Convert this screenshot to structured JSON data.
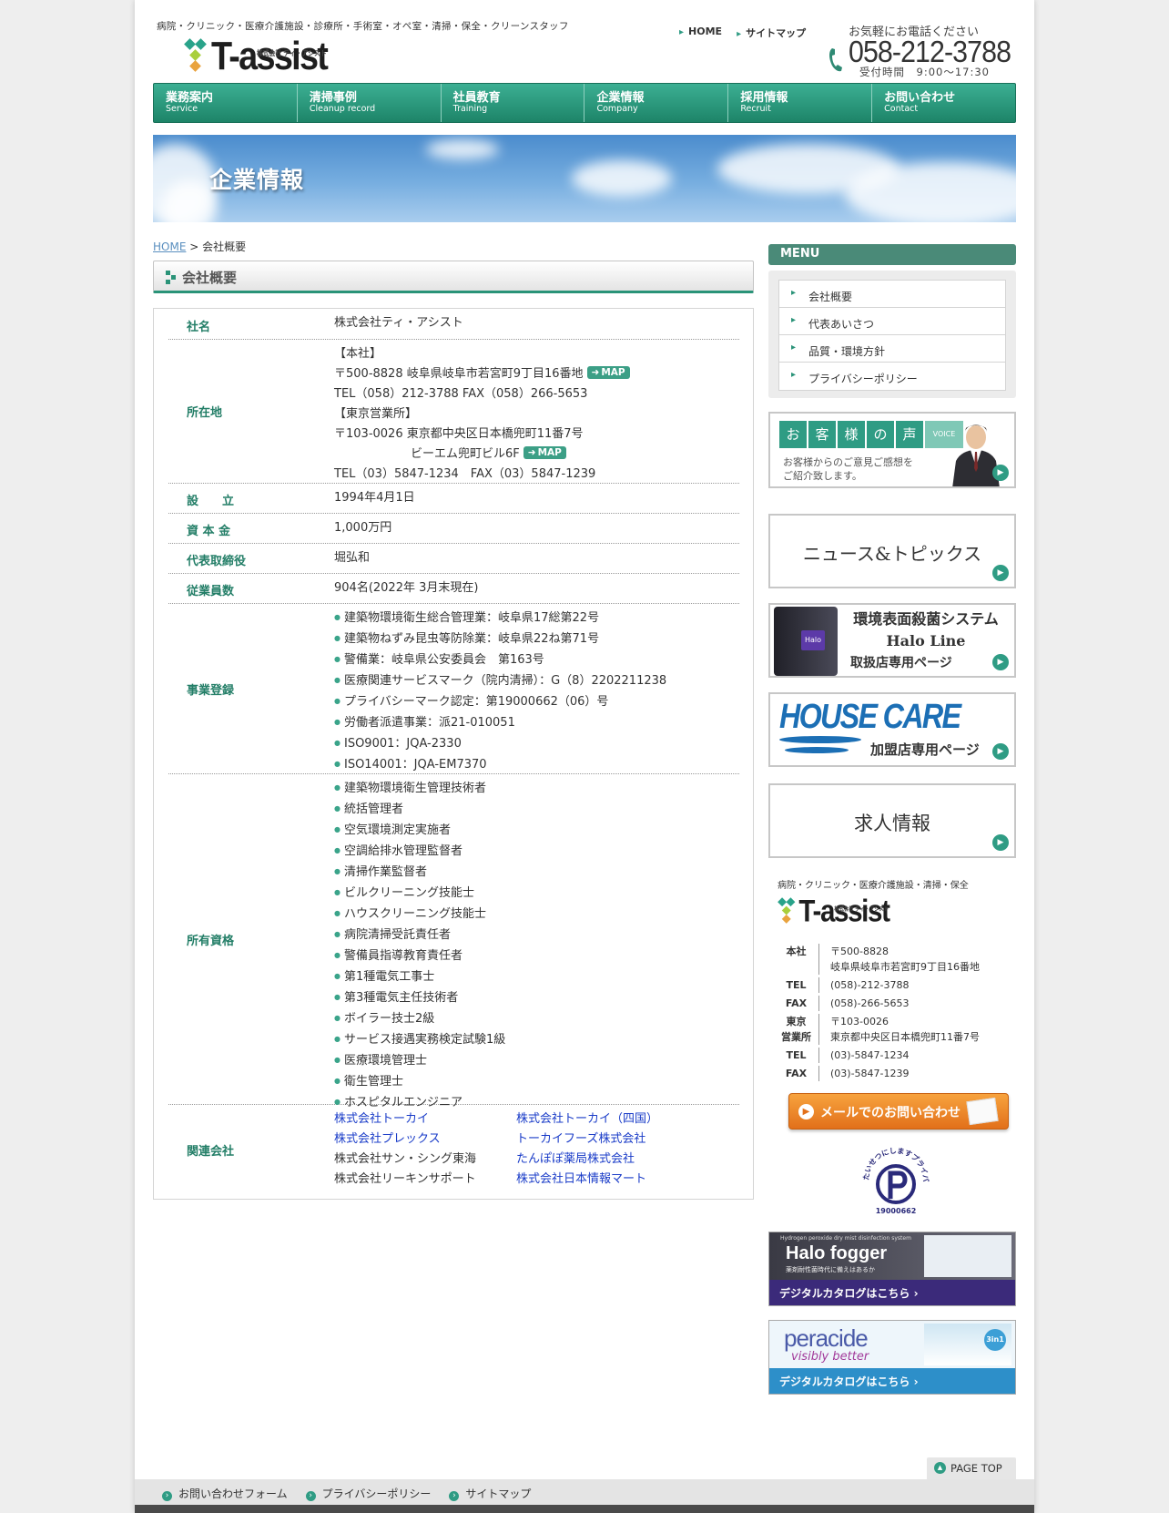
{
  "header": {
    "tagline": "病院・クリニック・医療介護施設・診療所・手術室・オペ室・清掃・保全・クリーンスタッフ",
    "logo_text": "T-assist",
    "logo_kana": "株式会社 ティ・アシスト",
    "top_links": [
      "HOME",
      "サイトマップ"
    ],
    "phone_note": "お気軽にお電話ください",
    "phone": "058-212-3788",
    "hours": "受付時間　9:00～17:30"
  },
  "nav": [
    {
      "jp": "業務案内",
      "en": "Service"
    },
    {
      "jp": "清掃事例",
      "en": "Cleanup record"
    },
    {
      "jp": "社員教育",
      "en": "Training"
    },
    {
      "jp": "企業情報",
      "en": "Company"
    },
    {
      "jp": "採用情報",
      "en": "Recruit"
    },
    {
      "jp": "お問い合わせ",
      "en": "Contact"
    }
  ],
  "hero_title": "企業情報",
  "breadcrumb": {
    "home": "HOME",
    "sep": " > ",
    "current": "会社概要"
  },
  "section_title": "会社概要",
  "company": {
    "name_label": "社名",
    "name": "株式会社ティ・アシスト",
    "address_label": "所在地",
    "hq_heading": "【本社】",
    "hq_address": "〒500-8828 岐阜県岐阜市若宮町9丁目16番地",
    "hq_tel": "TEL（058）212-3788 FAX（058）266-5653",
    "tokyo_heading": "【東京営業所】",
    "tokyo_address": "〒103-0026 東京都中央区日本橋兜町11番7号",
    "tokyo_building": "ビーエム兜町ビル6F",
    "tokyo_tel": "TEL（03）5847-1234　FAX（03）5847-1239",
    "map_label": "MAP",
    "founded_label": "設　　立",
    "founded": "1994年4月1日",
    "capital_label": "資 本 金",
    "capital": "1,000万円",
    "ceo_label": "代表取締役",
    "ceo": "堀弘和",
    "employees_label": "従業員数",
    "employees": "904名(2022年 3月末現在)",
    "registration_label": "事業登録",
    "registrations": [
      "建築物環境衛生総合管理業：岐阜県17総第22号",
      "建築物ねずみ昆虫等防除業：岐阜県22ね第71号",
      "警備業：岐阜県公安委員会　第163号",
      "医療関連サービスマーク（院内清掃）：G（8）2202211238",
      "プライバシーマーク認定：第19000662（06）号",
      "労働者派遣事業：派21-010051",
      "ISO9001：JQA-2330",
      "ISO14001：JQA-EM7370"
    ],
    "qualifications_label": "所有資格",
    "qualifications": [
      "建築物環境衛生管理技術者",
      "統括管理者",
      "空気環境測定実施者",
      "空調給排水管理監督者",
      "清掃作業監督者",
      "ビルクリーニング技能士",
      "ハウスクリーニング技能士",
      "病院清掃受託責任者",
      "警備員指導教育責任者",
      "第1種電気工事士",
      "第3種電気主任技術者",
      "ボイラー技士2級",
      "サービス接遇実務検定試験1級",
      "医療環境管理士",
      "衛生管理士",
      "ホスピタルエンジニア"
    ],
    "related_label": "関連会社",
    "related": [
      "株式会社トーカイ",
      "株式会社トーカイ（四国）",
      "株式会社プレックス",
      "トーカイフーズ株式会社",
      "株式会社サン・シング東海",
      "たんぽぽ薬局株式会社",
      "株式会社リーキンサポート",
      "株式会社日本情報マート"
    ]
  },
  "sidebar": {
    "menu_title": "MENU",
    "menu_items": [
      "会社概要",
      "代表あいさつ",
      "品質・環境方針",
      "プライバシーポリシー"
    ],
    "voice_chars": [
      "お",
      "客",
      "様",
      "の",
      "声"
    ],
    "voice_en": "VOICE",
    "voice_sub1": "お客様からのご意見ご感想を",
    "voice_sub2": "ご紹介致します。",
    "news": "ニュース&トピックス",
    "halo_line1": "環境表面殺菌システム",
    "halo_line2": "Halo Line",
    "halo_line3": "取扱店専用ページ",
    "halo_device": "Halo",
    "housecare": "HOUSE CARE",
    "housecare_sub": "加盟店専用ページ",
    "recruit": "求人情報",
    "contact_tagline": "病院・クリニック・医療介護施設・清掃・保全",
    "contact_rows": [
      {
        "k": "本社",
        "v": "〒500-8828"
      },
      {
        "k": "",
        "v": "岐阜県岐阜市若宮町9丁目16番地"
      },
      {
        "k": "TEL",
        "v": "(058)-212-3788"
      },
      {
        "k": "FAX",
        "v": "(058)-266-5653"
      },
      {
        "k": "東京",
        "v": "〒103-0026"
      },
      {
        "k": "営業所",
        "v": "東京都中央区日本橋兜町11番7号"
      },
      {
        "k": "TEL",
        "v": "(03)-5847-1234"
      },
      {
        "k": "FAX",
        "v": "(03)-5847-1239"
      }
    ],
    "mail_button": "メールでのお問い合わせ",
    "pmark_text": "たいせつにしますプライバシー",
    "pmark_number": "19000662",
    "halofogger_title": "Halo fogger",
    "halofogger_sub": "Hydrogen peroxide dry mist disinfection system",
    "halofogger_catch": "薬剤耐性菌時代に備えはあるか",
    "peracide_title": "peracide",
    "peracide_sub": "visibly better",
    "peracide_badge": "3in1",
    "catalog_label": "デジタルカタログはこちら ›"
  },
  "footer": {
    "page_top": "PAGE TOP",
    "links": [
      "お問い合わせフォーム",
      "プライバシーポリシー",
      "サイトマップ"
    ]
  },
  "colors": {
    "brand_green": "#2a9378",
    "link_blue": "#1a3cc8",
    "orange": "#e2701a"
  }
}
